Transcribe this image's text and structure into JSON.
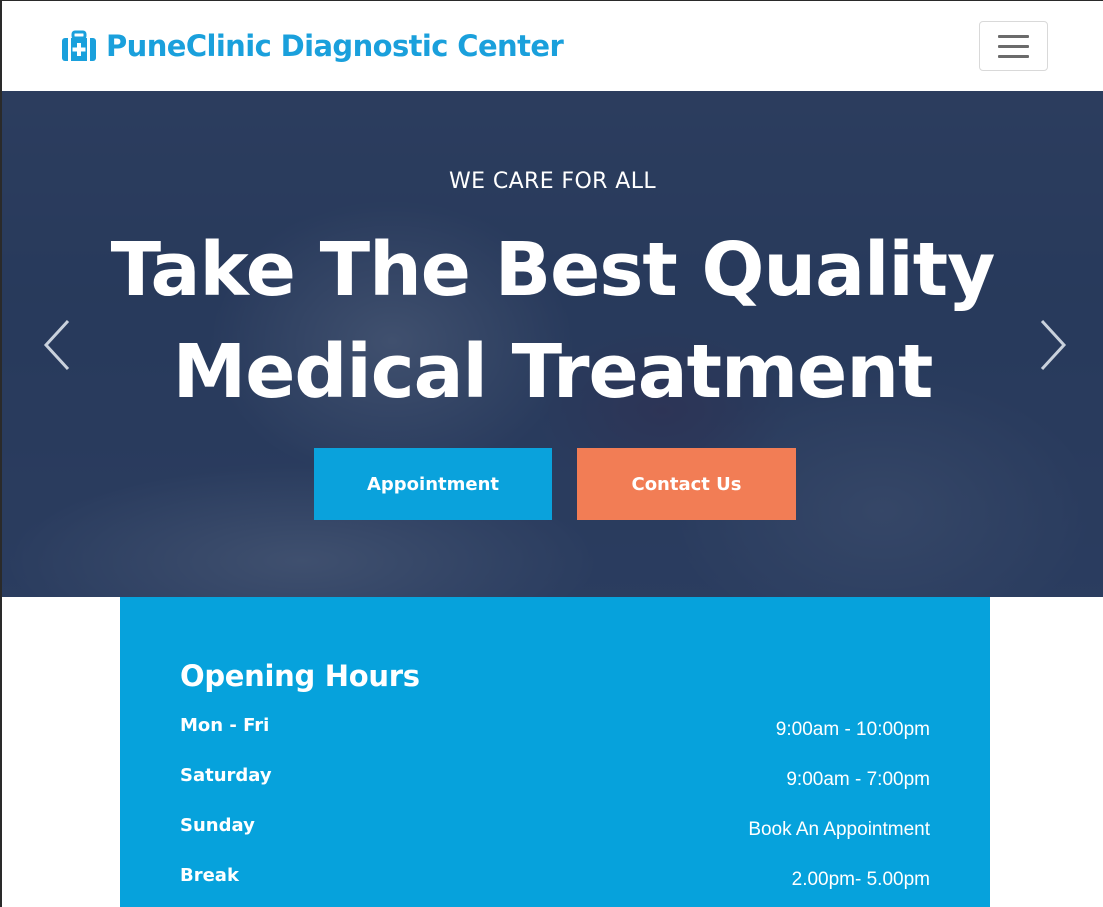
{
  "navbar": {
    "brand": "PuneClinic Diagnostic Center",
    "brand_icon": "medical-kit-icon",
    "toggler_icon": "hamburger-menu-icon"
  },
  "hero": {
    "eyebrow": "WE CARE FOR ALL",
    "title_line1": "Take The Best Quality",
    "title_line2": "Medical Treatment",
    "appointment_label": "Appointment",
    "contact_label": "Contact Us",
    "prev_icon": "chevron-left-icon",
    "next_icon": "chevron-right-icon"
  },
  "hours": {
    "title": "Opening Hours",
    "rows": [
      {
        "day": "Mon - Fri",
        "time": "9:00am - 10:00pm"
      },
      {
        "day": "Saturday",
        "time": "9:00am - 7:00pm"
      },
      {
        "day": "Sunday",
        "time": "Book An Appointment"
      },
      {
        "day": "Break",
        "time": "2.00pm- 5.00pm"
      }
    ]
  },
  "colors": {
    "brand": "#1aa0dc",
    "primary_button": "#0aa2dc",
    "secondary_button": "#f27d55",
    "hours_panel": "#06a2dc",
    "hero_overlay": "#1b2d4f"
  }
}
